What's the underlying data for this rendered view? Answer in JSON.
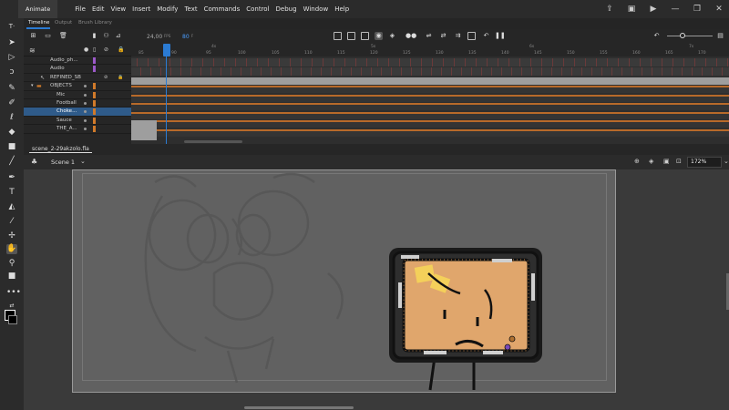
{
  "app": {
    "name": "Animate"
  },
  "menu": [
    "File",
    "Edit",
    "View",
    "Insert",
    "Modify",
    "Text",
    "Commands",
    "Control",
    "Debug",
    "Window",
    "Help"
  ],
  "panel_tabs": [
    {
      "label": "Timeline",
      "active": true
    },
    {
      "label": "Output",
      "active": false
    },
    {
      "label": "Brush Library",
      "active": false
    }
  ],
  "timeline": {
    "fps": "24,00",
    "fps_unit": "FPS",
    "frame": "80",
    "frame_unit": "F",
    "ruler_ticks": [
      "85",
      "90",
      "95",
      "100",
      "105",
      "110",
      "115",
      "120",
      "125",
      "130",
      "135",
      "140",
      "145",
      "150",
      "155",
      "160",
      "165",
      "170",
      "175",
      "180"
    ],
    "seconds": [
      "4s",
      "5s",
      "6s",
      "7s"
    ]
  },
  "layers": [
    {
      "name": "Audio_ph...",
      "color": "#9b59c9",
      "selected": false,
      "group": false
    },
    {
      "name": "Audio",
      "color": "#9b59c9",
      "selected": false,
      "group": false
    },
    {
      "name": "REFINED_SB",
      "color": "#9b59c9",
      "selected": false,
      "group": false
    },
    {
      "name": "OBJECTS",
      "color": "#d07a2a",
      "selected": false,
      "group": true
    },
    {
      "name": "Mic",
      "color": "#d07a2a",
      "selected": false,
      "group": false
    },
    {
      "name": "Football",
      "color": "#d07a2a",
      "selected": false,
      "group": false
    },
    {
      "name": "Choke...",
      "color": "#d07a2a",
      "selected": true,
      "group": false
    },
    {
      "name": "Sauce",
      "color": "#d07a2a",
      "selected": false,
      "group": false
    },
    {
      "name": "THE_A...",
      "color": "#d07a2a",
      "selected": false,
      "group": false
    }
  ],
  "document": {
    "tab": "scene_2-29akzolo.fla"
  },
  "scene": {
    "name": "Scene 1",
    "zoom": "172%"
  },
  "colors": {
    "accent": "#2b7bd3",
    "stage": "#616161",
    "pasteboard": "#3a3a3a",
    "board_fill": "#e0a66c"
  }
}
